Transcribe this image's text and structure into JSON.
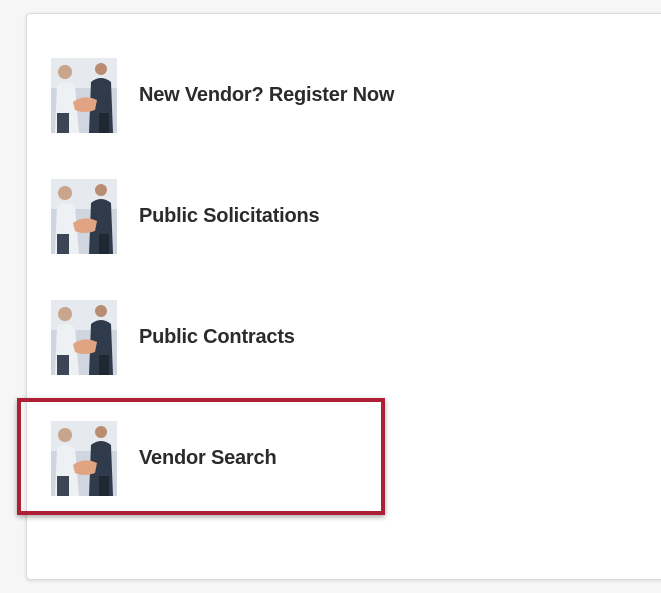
{
  "links": [
    {
      "label": "New Vendor? Register Now",
      "icon": "handshake-icon"
    },
    {
      "label": "Public Solicitations",
      "icon": "handshake-icon"
    },
    {
      "label": "Public Contracts",
      "icon": "handshake-icon"
    },
    {
      "label": "Vendor Search",
      "icon": "handshake-icon"
    }
  ],
  "colors": {
    "highlight_border": "#ad1f35",
    "label_text": "#2b2b2b",
    "panel_bg": "#ffffff",
    "page_bg": "#f6f6f6"
  }
}
